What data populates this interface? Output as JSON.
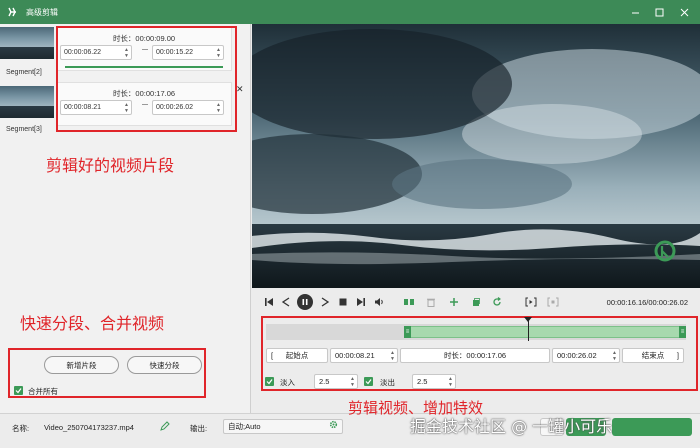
{
  "window": {
    "title": "高级剪辑"
  },
  "segments": [
    {
      "label": "Segment[2]",
      "duration": "时长：00:00:09.00",
      "start": "00:00:06.22",
      "end": "00:00:15.22"
    },
    {
      "label": "Segment[3]",
      "duration": "时长：00:00:17.06",
      "start": "00:00:08.21",
      "end": "00:00:26.02"
    }
  ],
  "annotations": {
    "clips": "剪辑好的视频片段",
    "split_merge": "快速分段、合并视频",
    "effects": "剪辑视频、增加特效"
  },
  "left_actions": {
    "new_segment": "新增片段",
    "quick_split": "快速分段",
    "merge_all": "合并所有"
  },
  "player": {
    "timecode": "00:00:16.16/00:00:26.02"
  },
  "trim": {
    "start_label": "起始点",
    "start_value": "00:00:08.21",
    "duration_label": "时长：00:00:17.06",
    "end_value": "00:00:26.02",
    "end_label": "结束点",
    "selection_start_fraction": 0.333,
    "selection_end_fraction": 1.0,
    "playhead_fraction": 0.622
  },
  "effects": {
    "fade_in_label": "淡入",
    "fade_in_value": "2.5",
    "fade_out_label": "淡出",
    "fade_out_value": "2.5"
  },
  "bottom": {
    "name_label": "名称:",
    "name_value": "Video_250704173237.mp4",
    "output_label": "输出:",
    "output_value": "自动;Auto"
  },
  "watermark": "掘金技术社区 @ 一罐小可乐",
  "colors": {
    "accent": "#3c9a57",
    "annotation": "#e0252a",
    "titlebar": "#3d8a57"
  }
}
